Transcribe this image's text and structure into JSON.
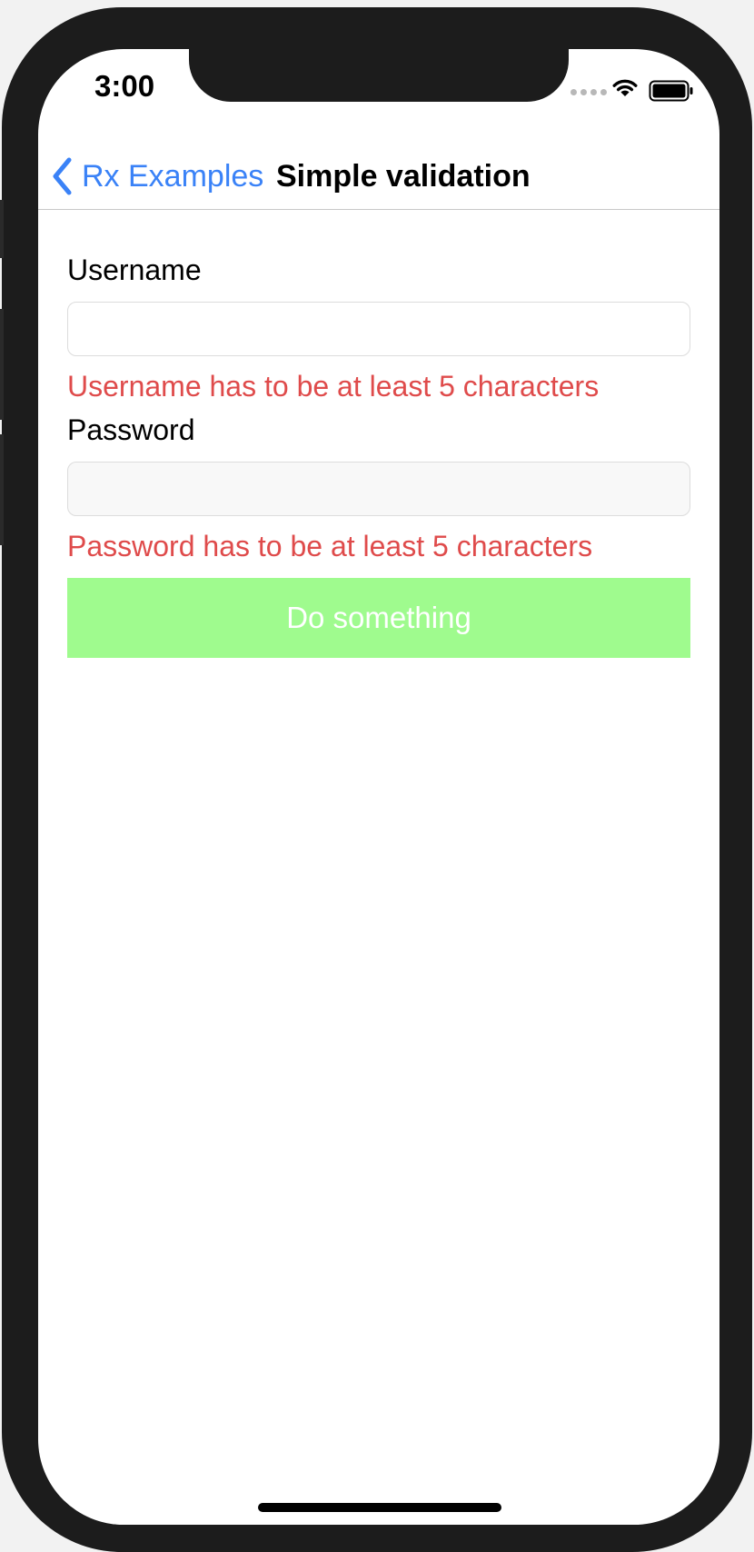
{
  "status_bar": {
    "time": "3:00"
  },
  "nav": {
    "back_label": "Rx Examples",
    "title": "Simple validation"
  },
  "form": {
    "username_label": "Username",
    "username_value": "",
    "username_error": "Username has to be at least 5 characters",
    "password_label": "Password",
    "password_value": "",
    "password_error": "Password has to be at least 5 characters",
    "submit_label": "Do something"
  },
  "colors": {
    "accent": "#3a82f7",
    "error": "#df4b4b",
    "button_bg": "#9ffb8e",
    "button_text": "#ffffff"
  },
  "icons": {
    "back": "chevron-left-icon",
    "signal": "cellular-signal-icon",
    "wifi": "wifi-icon",
    "battery": "battery-icon"
  }
}
